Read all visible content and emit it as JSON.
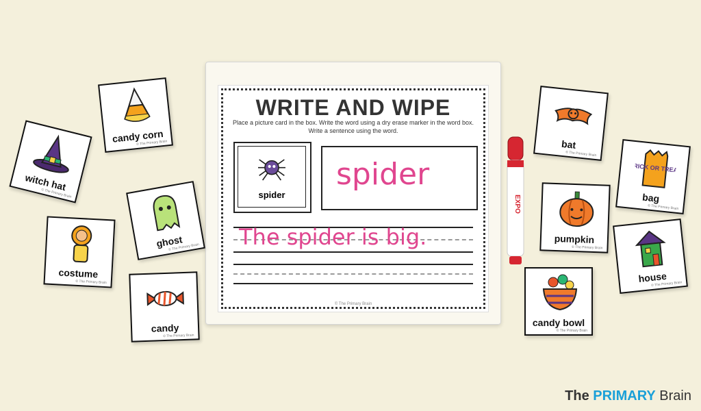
{
  "sheet": {
    "title": "WRITE AND WIPE",
    "instructions": "Place a picture card in the box. Write the word using a dry erase marker in the word box. Write a sentence using the word.",
    "picture_label": "spider",
    "written_word": "spider",
    "written_sentence": "The spider is big.",
    "footer": "© The Primary Brain"
  },
  "cards_left": [
    {
      "label": "candy corn",
      "icon": "candy-corn-icon"
    },
    {
      "label": "witch hat",
      "icon": "witch-hat-icon"
    },
    {
      "label": "ghost",
      "icon": "ghost-icon"
    },
    {
      "label": "costume",
      "icon": "costume-icon"
    },
    {
      "label": "candy",
      "icon": "candy-icon"
    }
  ],
  "cards_right": [
    {
      "label": "bat",
      "icon": "bat-icon"
    },
    {
      "label": "bag",
      "icon": "bag-icon"
    },
    {
      "label": "pumpkin",
      "icon": "pumpkin-icon"
    },
    {
      "label": "house",
      "icon": "house-icon"
    },
    {
      "label": "candy bowl",
      "icon": "candy-bowl-icon"
    }
  ],
  "bag_text": "TRICK OR TREAT",
  "marker_brand": "EXPO",
  "card_credit": "© The Primary Brain",
  "brand": {
    "prefix": "The ",
    "primary": "PRIMARY",
    "suffix": " Brain"
  },
  "colors": {
    "ink": "#e0468f",
    "background": "#f4f0dc",
    "brand_blue": "#1aa0d8"
  }
}
